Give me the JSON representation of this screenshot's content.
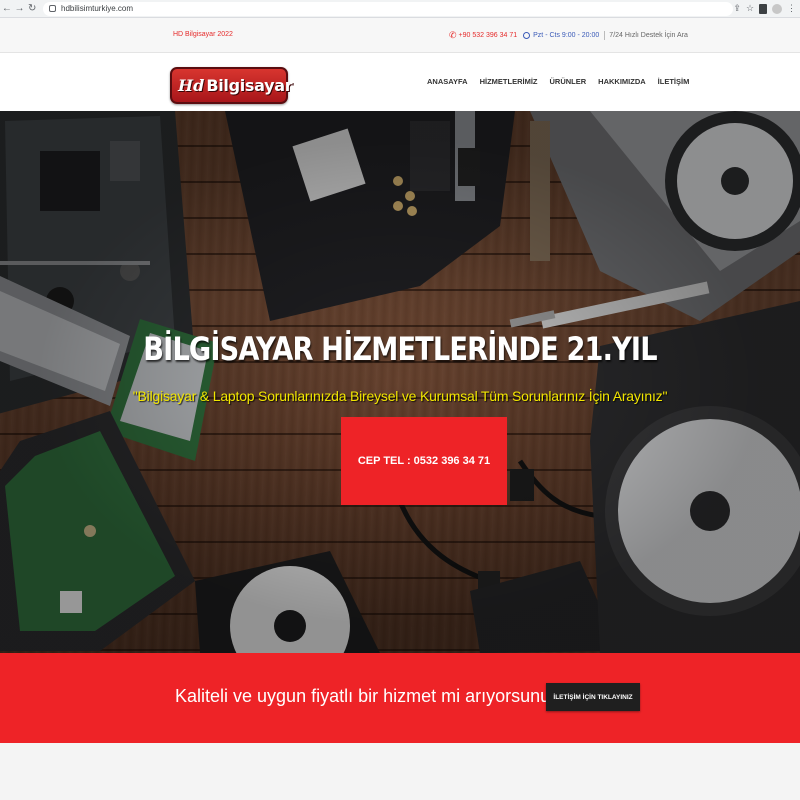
{
  "browser": {
    "url": "hdbilisimturkiye.com"
  },
  "topbar": {
    "brand_note": "HD Bilgisayar 2022",
    "phone": "+90 532 396 34 71",
    "hours": "Pzt - Cts 9:00 - 20:00",
    "support": "7/24 Hızlı Destek İçin Ara",
    "accent_color": "#e52b2b"
  },
  "header": {
    "logo_hd": "Hd",
    "logo_text": "Bilgisayar",
    "menu": [
      "ANASAYFA",
      "HİZMETLERİMİZ",
      "ÜRÜNLER",
      "HAKKIMIZDA",
      "İLETİŞİM"
    ]
  },
  "hero": {
    "title": "BİLGİSAYAR HİZMETLERİNDE 21.YIL",
    "subtitle": "\"Bilgisayar & Laptop Sorunlarınızda Bireysel ve Kurumsal Tüm Sorunlarınız İçin Arayınız\"",
    "cta_label": "CEP TEL : 0532 396 34 71",
    "cta_color": "#ee2327"
  },
  "band": {
    "text": "Kaliteli ve uygun fiyatlı bir hizmet mi arıyorsunuz ?",
    "button_label": "İLETİŞİM İÇİN TIKLAYINIZ"
  }
}
